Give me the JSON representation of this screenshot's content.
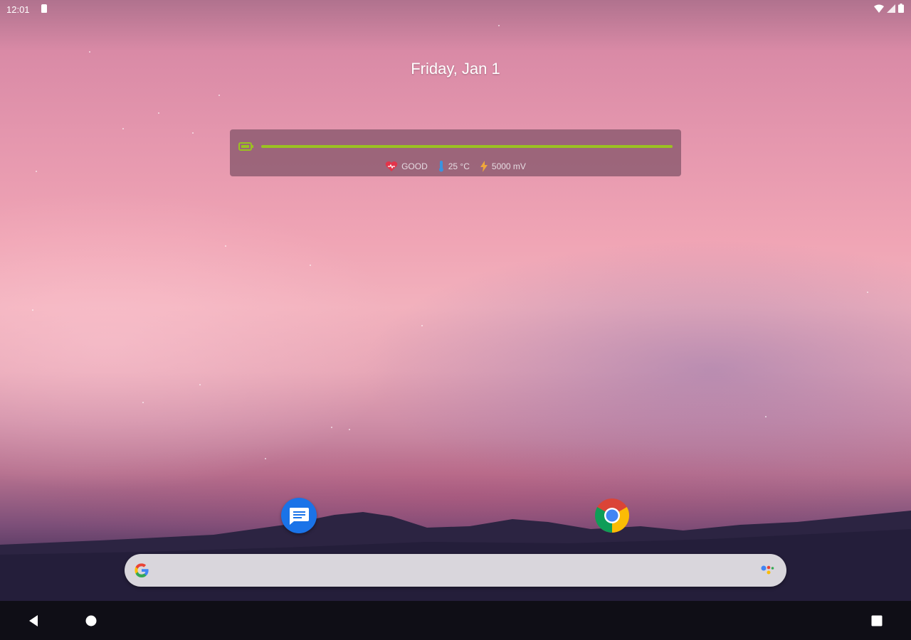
{
  "status_bar": {
    "time": "12:01",
    "left_icons": [
      "sd-card-icon"
    ],
    "right_icons": [
      "wifi-icon",
      "cell-signal-icon",
      "battery-icon"
    ]
  },
  "home": {
    "date": "Friday, Jan 1"
  },
  "battery_widget": {
    "level_fraction": 1.0,
    "bar_color": "#9bc121",
    "health": "GOOD",
    "temperature": "25 °C",
    "voltage": "5000 mV",
    "icons": [
      "battery-charging-icon",
      "heart-icon",
      "thermometer-icon",
      "lightning-icon"
    ]
  },
  "dock": {
    "apps": [
      {
        "name": "Messages",
        "icon": "messages-icon"
      },
      {
        "name": "Chrome",
        "icon": "chrome-icon"
      }
    ]
  },
  "search": {
    "icons": [
      "google-g-icon",
      "google-assistant-icon"
    ]
  },
  "nav_bar": {
    "buttons": [
      "back",
      "home",
      "recents"
    ]
  },
  "colors": {
    "accent_green": "#9bc121",
    "search_bg": "#d9d6dc",
    "nav_bg": "#0f0e16"
  }
}
